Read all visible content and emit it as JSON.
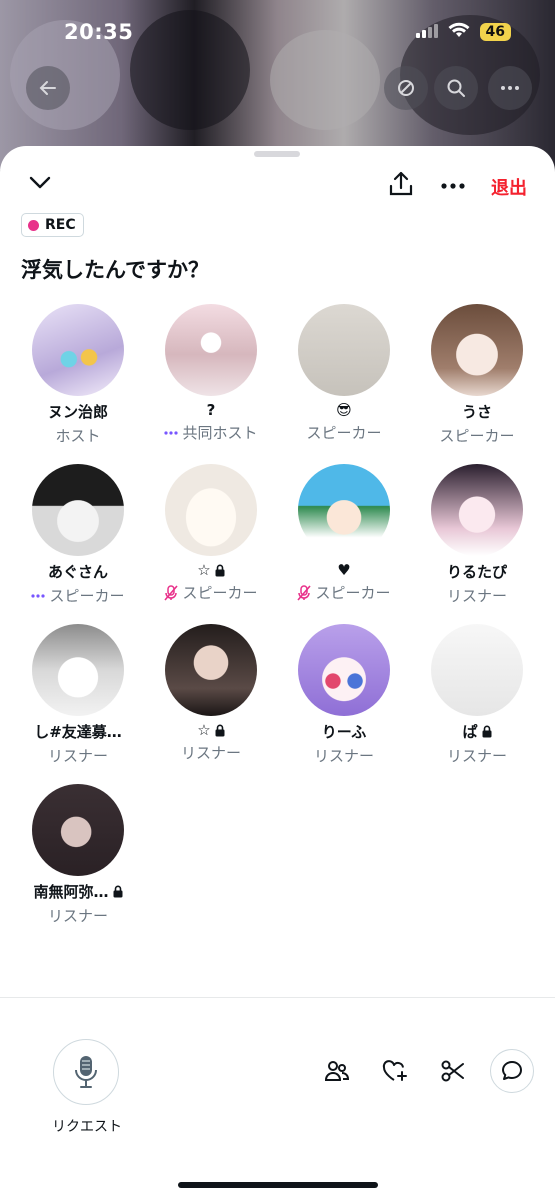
{
  "status_bar": {
    "time": "20:35",
    "battery": "46"
  },
  "room": {
    "rec_label": "REC",
    "title": "浮気したんですか？",
    "leave_label": "退出"
  },
  "participants": [
    {
      "name": "ヌン治郎",
      "role": "ホスト",
      "lock": false,
      "role_icon": ""
    },
    {
      "name": "?",
      "role": "共同ホスト",
      "lock": false,
      "role_icon": "speaking-dots-icon"
    },
    {
      "name": "😎",
      "role": "スピーカー",
      "lock": false,
      "role_icon": ""
    },
    {
      "name": "うさ",
      "role": "スピーカー",
      "lock": false,
      "role_icon": ""
    },
    {
      "name": "あぐさん",
      "role": "スピーカー",
      "lock": false,
      "role_icon": "speaking-dots-icon"
    },
    {
      "name": "☆",
      "role": "スピーカー",
      "lock": true,
      "role_icon": "mic-muted-icon"
    },
    {
      "name": "♥",
      "role": "スピーカー",
      "lock": false,
      "role_icon": "mic-muted-icon"
    },
    {
      "name": "りるたぴ",
      "role": "リスナー",
      "lock": false,
      "role_icon": ""
    },
    {
      "name": "し#友達募…",
      "role": "リスナー",
      "lock": false,
      "role_icon": ""
    },
    {
      "name": "☆",
      "role": "リスナー",
      "lock": true,
      "role_icon": ""
    },
    {
      "name": "りーふ",
      "role": "リスナー",
      "lock": false,
      "role_icon": ""
    },
    {
      "name": "ぱ",
      "role": "リスナー",
      "lock": true,
      "role_icon": ""
    },
    {
      "name": "南無阿弥…",
      "role": "リスナー",
      "lock": true,
      "role_icon": ""
    }
  ],
  "bottom": {
    "request_label": "リクエスト"
  },
  "colors": {
    "accent_red": "#f4212e",
    "rec_dot": "#e8318a",
    "muted_role": "#6b7681",
    "speaking_dots": "#7856ff"
  }
}
